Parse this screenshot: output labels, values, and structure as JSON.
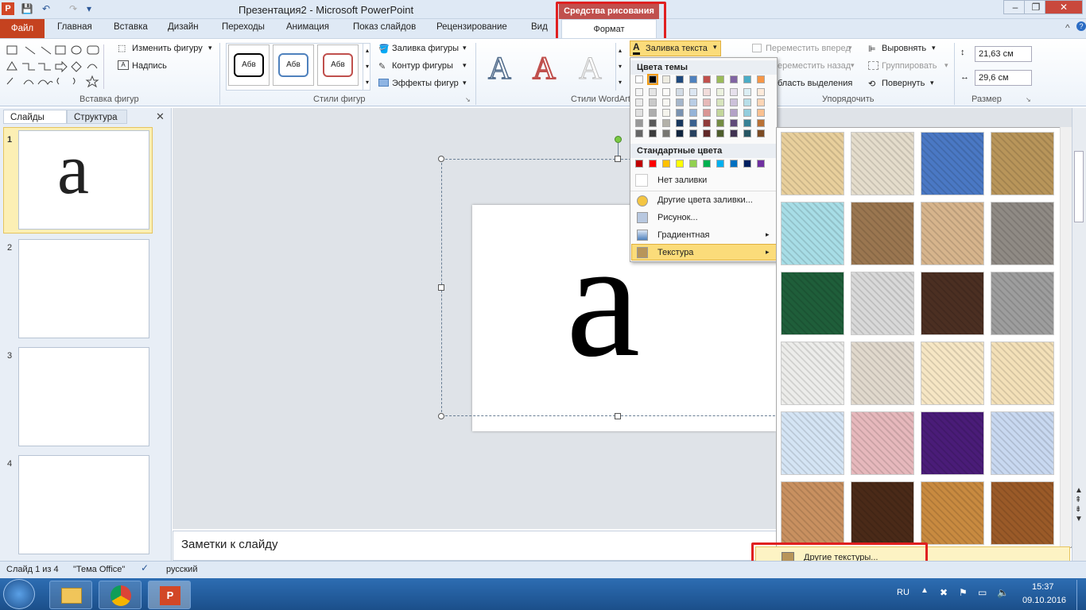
{
  "app": {
    "title": "Презентация2 - Microsoft PowerPoint",
    "context_group": "Средства рисования"
  },
  "tabs": [
    "Файл",
    "Главная",
    "Вставка",
    "Дизайн",
    "Переходы",
    "Анимация",
    "Показ слайдов",
    "Рецензирование",
    "Вид",
    "Формат"
  ],
  "ribbon": {
    "insert_shapes": {
      "change_shape": "Изменить фигуру",
      "textbox": "Надпись",
      "label": "Вставка фигур"
    },
    "shape_styles": {
      "sample": "Абв",
      "fill": "Заливка фигуры",
      "outline": "Контур фигуры",
      "effects": "Эффекты фигур",
      "label": "Стили фигур"
    },
    "wordart": {
      "text_fill": "Заливка текста",
      "label": "Стили WordArt"
    },
    "arrange": {
      "bring_forward": "Переместить вперед",
      "send_backward": "ереместить назад",
      "selection_pane": "бласть выделения",
      "align": "Выровнять",
      "group": "Группировать",
      "rotate": "Повернуть",
      "label": "Упорядочить"
    },
    "size": {
      "height": "21,63 см",
      "width": "29,6 см",
      "label": "Размер"
    }
  },
  "left_pane": {
    "tab_slides": "Слайды",
    "tab_outline": "Структура",
    "slides": [
      "1",
      "2",
      "3",
      "4"
    ],
    "slide1_text": "a"
  },
  "slide": {
    "big_text": "a"
  },
  "notes_placeholder": "Заметки к слайду",
  "dropdown": {
    "theme_colors": "Цвета темы",
    "standard_colors": "Стандартные цвета",
    "no_fill": "Нет заливки",
    "more_colors": "Другие цвета заливки...",
    "picture": "Рисунок...",
    "gradient": "Градиентная",
    "texture": "Текстура",
    "theme_top": [
      "#ffffff",
      "#000000",
      "#eeece1",
      "#1f497d",
      "#4f81bd",
      "#c0504d",
      "#9bbb59",
      "#8064a2",
      "#4bacc6",
      "#f79646"
    ],
    "standard": [
      "#c00000",
      "#ff0000",
      "#ffc000",
      "#ffff00",
      "#92d050",
      "#00b050",
      "#00b0f0",
      "#0070c0",
      "#002060",
      "#7030a0"
    ]
  },
  "textures": {
    "colors": [
      "#e8cf9c",
      "#e4dccb",
      "#4a78c4",
      "#b8955a",
      "#a7dde6",
      "#9a7650",
      "#d6b48c",
      "#8f8a84",
      "#1f5e3a",
      "#d8d8d8",
      "#4b2f22",
      "#9d9d9d",
      "#ececea",
      "#e0d8cc",
      "#f6e6c4",
      "#f3e0b8",
      "#d4e4f4",
      "#e6b8bc",
      "#4a1c78",
      "#c8d8f0",
      "#c89060",
      "#4a2a18",
      "#c88a40",
      "#9a5a28"
    ],
    "more": "Другие текстуры..."
  },
  "status": {
    "slide": "Слайд 1 из 4",
    "theme": "\"Тема Office\"",
    "lang": "русский"
  },
  "taskbar": {
    "lang": "RU",
    "time": "15:37",
    "date": "09.10.2016"
  }
}
